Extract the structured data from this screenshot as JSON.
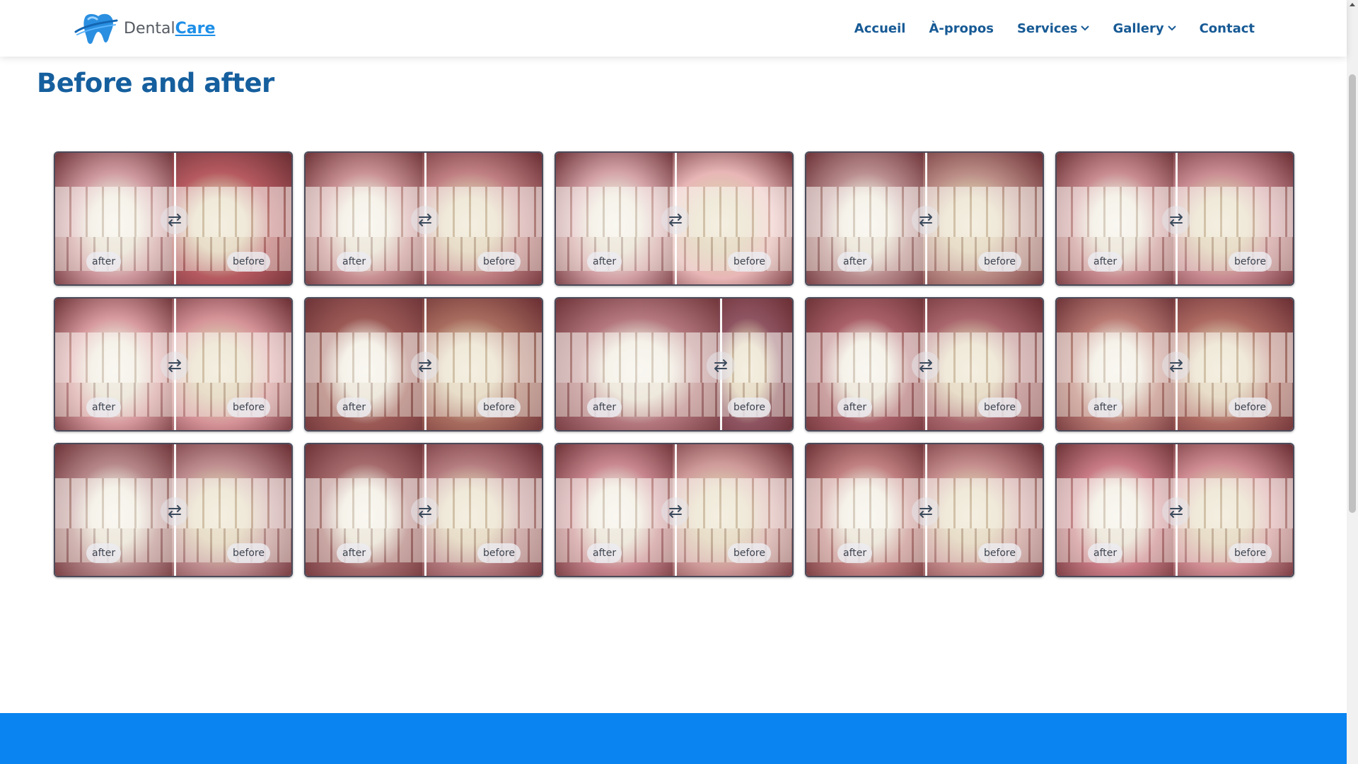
{
  "brand": {
    "name": "Dental",
    "accent": "Care",
    "colors": {
      "primary": "#175a95",
      "accent": "#1e8fe8",
      "footer": "#0a84f1"
    }
  },
  "nav": {
    "items": [
      {
        "label": "Accueil",
        "dropdown": false
      },
      {
        "label": "À-propos",
        "dropdown": false
      },
      {
        "label": "Services",
        "dropdown": true
      },
      {
        "label": "Gallery",
        "dropdown": true
      },
      {
        "label": "Contact",
        "dropdown": false
      }
    ]
  },
  "page": {
    "title": "Before and after"
  },
  "gallery": {
    "after_label": "after",
    "before_label": "before",
    "handle_icon": "swap-arrows-icon",
    "items": [
      {
        "split": 50,
        "after_color": "#cf9aa0",
        "before_color": "#b55a60"
      },
      {
        "split": 50,
        "after_color": "#c99093",
        "before_color": "#c08083"
      },
      {
        "split": 50,
        "after_color": "#d4a3a8",
        "before_color": "#e8b6b6"
      },
      {
        "split": 50,
        "after_color": "#b98c8e",
        "before_color": "#b98a84"
      },
      {
        "split": 50,
        "after_color": "#c88b90",
        "before_color": "#c98b92"
      },
      {
        "split": 50,
        "after_color": "#d79a9e",
        "before_color": "#d59398"
      },
      {
        "split": 50,
        "after_color": "#9c5a56",
        "before_color": "#a76b5e"
      },
      {
        "split": 69,
        "after_color": "#b3777d",
        "before_color": "#8e5461"
      },
      {
        "split": 50,
        "after_color": "#a96068",
        "before_color": "#a9676d"
      },
      {
        "split": 50,
        "after_color": "#b97a73",
        "before_color": "#ad6a62"
      },
      {
        "split": 50,
        "after_color": "#b68789",
        "before_color": "#bd8b8e"
      },
      {
        "split": 50,
        "after_color": "#a56a6c",
        "before_color": "#b47b7f"
      },
      {
        "split": 50,
        "after_color": "#c8868e",
        "before_color": "#cf9a9a"
      },
      {
        "split": 50,
        "after_color": "#c07f80",
        "before_color": "#c48b8c"
      },
      {
        "split": 50,
        "after_color": "#c97c86",
        "before_color": "#cf8d93"
      }
    ]
  }
}
